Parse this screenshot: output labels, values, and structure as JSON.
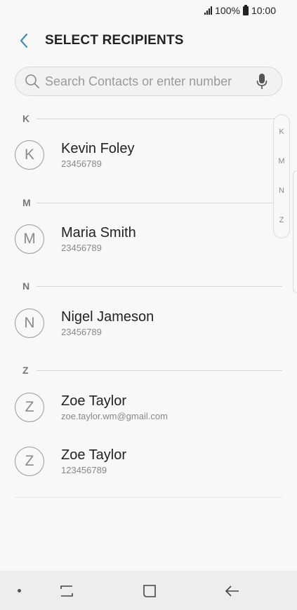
{
  "status_bar": {
    "battery": "100%",
    "time": "10:00"
  },
  "header": {
    "title": "SELECT RECIPIENTS"
  },
  "search": {
    "placeholder": "Search Contacts or enter number"
  },
  "sections": [
    {
      "letter": "K",
      "contacts": [
        {
          "initial": "K",
          "name": "Kevin Foley",
          "detail": "23456789"
        }
      ]
    },
    {
      "letter": "M",
      "contacts": [
        {
          "initial": "M",
          "name": "Maria Smith",
          "detail": "23456789"
        }
      ]
    },
    {
      "letter": "N",
      "contacts": [
        {
          "initial": "N",
          "name": "Nigel Jameson",
          "detail": "23456789"
        }
      ]
    },
    {
      "letter": "Z",
      "contacts": [
        {
          "initial": "Z",
          "name": "Zoe Taylor",
          "detail": "zoe.taylor.wm@gmail.com"
        },
        {
          "initial": "Z",
          "name": "Zoe Taylor",
          "detail": "123456789"
        }
      ]
    }
  ],
  "index_scroller": [
    "K",
    "M",
    "N",
    "Z"
  ],
  "colors": {
    "accent": "#3c8fb8",
    "background": "#f8f8f8",
    "nav_bar": "#ededed"
  },
  "icons": {
    "back": "chevron-left-icon",
    "search": "search-icon",
    "mic": "mic-icon",
    "recents": "recents-icon",
    "home": "home-icon",
    "nav_back": "arrow-left-icon"
  }
}
